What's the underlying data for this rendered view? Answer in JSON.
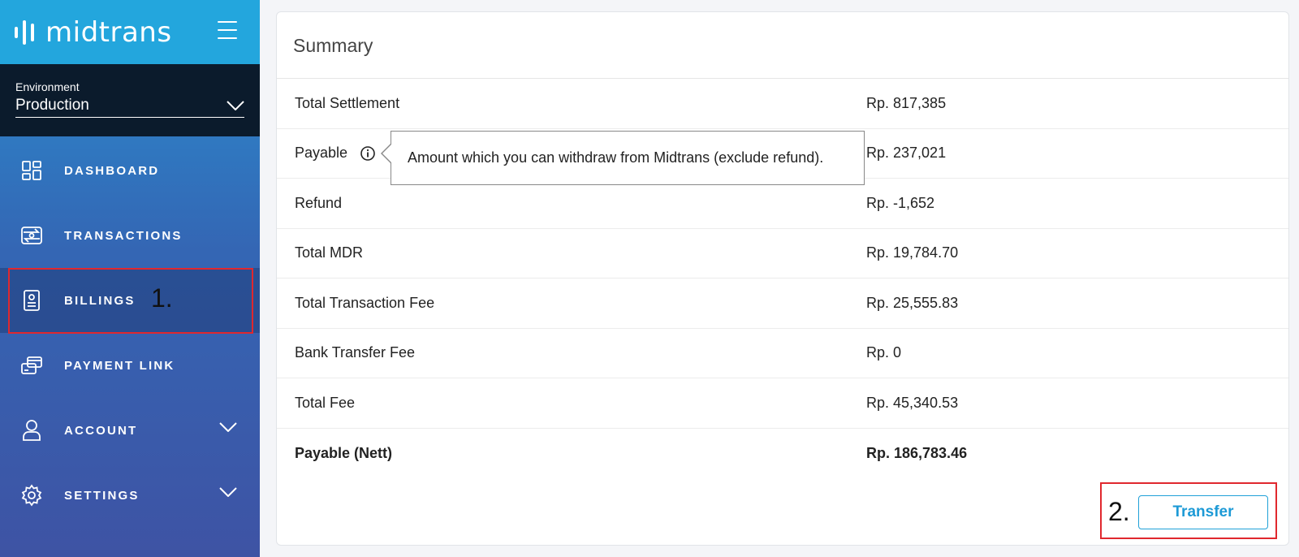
{
  "brand": {
    "name": "midtrans"
  },
  "environment": {
    "label": "Environment",
    "value": "Production"
  },
  "nav": [
    {
      "label": "DASHBOARD",
      "icon": "dashboard-icon"
    },
    {
      "label": "TRANSACTIONS",
      "icon": "transactions-icon"
    },
    {
      "label": "BILLINGS",
      "icon": "billings-icon",
      "active": true
    },
    {
      "label": "PAYMENT LINK",
      "icon": "payment-link-icon"
    },
    {
      "label": "ACCOUNT",
      "icon": "account-icon",
      "expandable": true
    },
    {
      "label": "SETTINGS",
      "icon": "settings-icon",
      "expandable": true
    }
  ],
  "annotations": {
    "step1": "1.",
    "step2": "2."
  },
  "summary": {
    "title": "Summary",
    "rows": [
      {
        "label": "Total Settlement",
        "value": "Rp. 817,385"
      },
      {
        "label": "Payable",
        "value": "Rp. 237,021"
      },
      {
        "label": "Refund",
        "value": "Rp. -1,652"
      },
      {
        "label": "Total MDR",
        "value": "Rp. 19,784.70"
      },
      {
        "label": "Total Transaction Fee",
        "value": "Rp. 25,555.83"
      },
      {
        "label": "Bank Transfer Fee",
        "value": "Rp. 0"
      },
      {
        "label": "Total Fee",
        "value": "Rp. 45,340.53"
      },
      {
        "label": "Payable (Nett)",
        "value": "Rp. 186,783.46"
      }
    ],
    "tooltip": "Amount which you can withdraw from Midtrans (exclude refund).",
    "transfer_label": "Transfer"
  },
  "colors": {
    "accent": "#1fa1d8",
    "annotation": "#e0282e",
    "env_bg": "#0b1b2c"
  }
}
